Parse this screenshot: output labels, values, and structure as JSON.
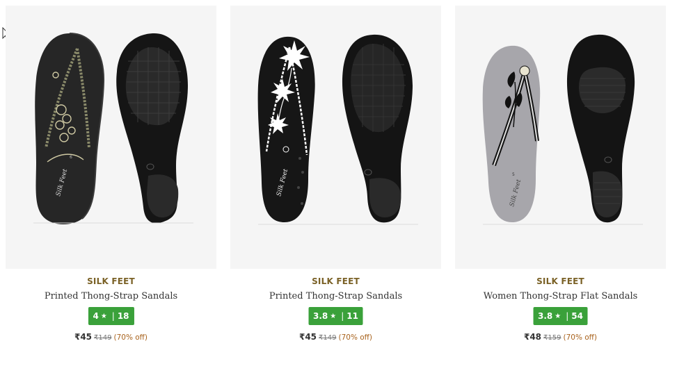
{
  "products": [
    {
      "brand": "SILK FEET",
      "name": "Printed Thong-Strap Sandals",
      "rating": "4",
      "rating_star": "★",
      "rating_sep": "|",
      "review_count": "18",
      "price": "₹45",
      "mrp": "₹149",
      "discount": "(70% off)",
      "image_icon": "black-printed-flip-flop-image",
      "sole_color": "#1c1c1c"
    },
    {
      "brand": "SILK FEET",
      "name": "Printed Thong-Strap Sandals",
      "rating": "3.8",
      "rating_star": "★",
      "rating_sep": "|",
      "review_count": "11",
      "price": "₹45",
      "mrp": "₹149",
      "discount": "(70% off)",
      "image_icon": "black-floral-flip-flop-image",
      "sole_color": "#141414"
    },
    {
      "brand": "SILK FEET",
      "name": "Women Thong-Strap Flat Sandals",
      "rating": "3.8",
      "rating_star": "★",
      "rating_sep": "|",
      "review_count": "54",
      "price": "₹48",
      "mrp": "₹159",
      "discount": "(70% off)",
      "image_icon": "grey-flip-flop-image",
      "sole_color": "#a7a6ab"
    }
  ],
  "colors": {
    "brand_text": "#7a6126",
    "rating_badge": "#3aa13a",
    "discount_text": "#a8621c",
    "image_bg": "#f5f5f5"
  }
}
